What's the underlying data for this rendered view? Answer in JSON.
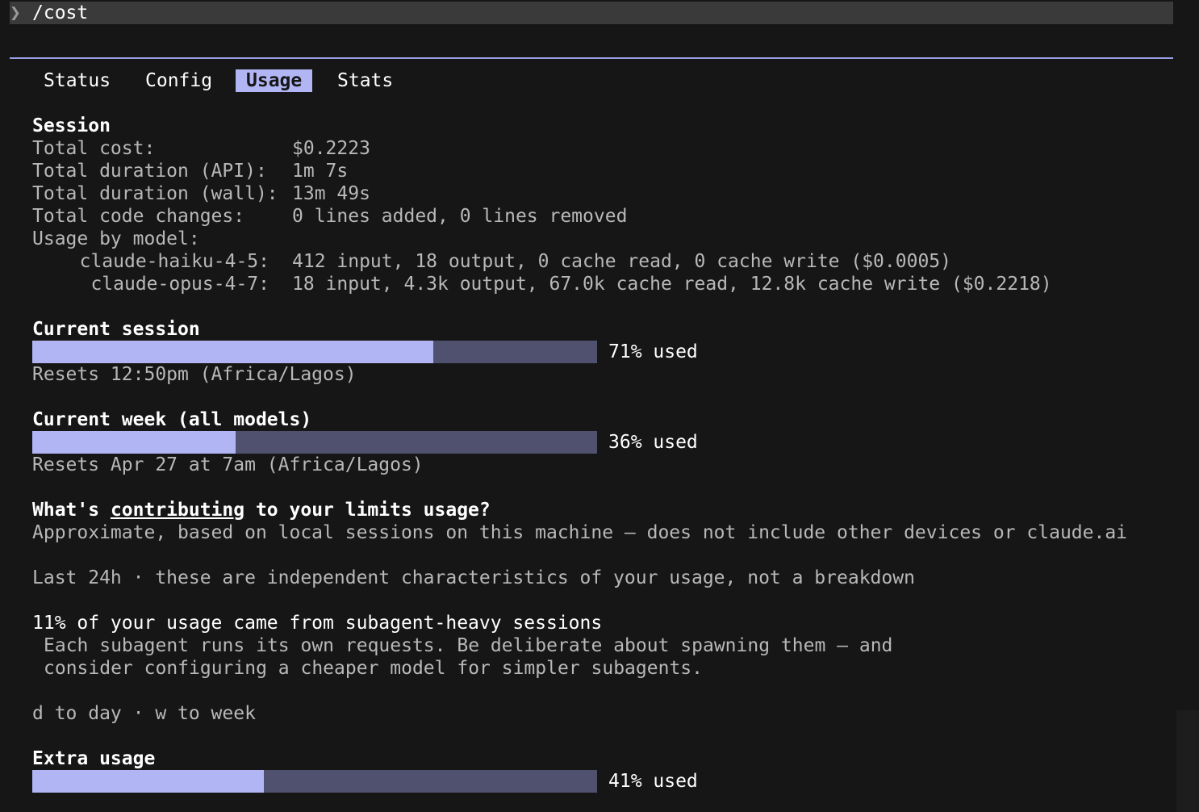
{
  "command": {
    "prompt_icon": "chevron-right-icon",
    "chevron": "❯",
    "text": "/cost"
  },
  "tabs": [
    {
      "label": "Status",
      "active": false
    },
    {
      "label": "Config",
      "active": false
    },
    {
      "label": "Usage",
      "active": true
    },
    {
      "label": "Stats",
      "active": false
    }
  ],
  "session": {
    "heading": "Session",
    "total_cost_label": "Total cost:",
    "total_cost_value": "$0.2223",
    "duration_api_label": "Total duration (API):",
    "duration_api_value": "1m 7s",
    "duration_wall_label": "Total duration (wall):",
    "duration_wall_value": "13m 49s",
    "code_changes_label": "Total code changes:",
    "code_changes_value": "0 lines added, 0 lines removed",
    "usage_by_model_label": "Usage by model:",
    "models": [
      {
        "name": "claude-haiku-4-5:",
        "usage": "412 input, 18 output, 0 cache read, 0 cache write ($0.0005)"
      },
      {
        "name": "claude-opus-4-7:",
        "usage": "18 input, 4.3k output, 67.0k cache read, 12.8k cache write ($0.2218)"
      }
    ]
  },
  "current_session": {
    "heading": "Current session",
    "percent_used": 71,
    "used_label": "71% used",
    "resets": "Resets 12:50pm (Africa/Lagos)"
  },
  "current_week": {
    "heading": "Current week (all models)",
    "percent_used": 36,
    "used_label": "36% used",
    "resets": "Resets Apr 27 at 7am (Africa/Lagos)"
  },
  "contributing": {
    "heading_pre": "What's ",
    "heading_link": "contributing",
    "heading_post": " to your limits usage?",
    "note": "Approximate, based on local sessions on this machine — does not include other devices or claude.ai",
    "period": "Last 24h · these are independent characteristics of your usage, not a breakdown",
    "insight_title": "11% of your usage came from subagent-heavy sessions",
    "insight_line1": "Each subagent runs its own requests. Be deliberate about spawning them — and",
    "insight_line2": "consider configuring a cheaper model for simpler subagents.",
    "keys_hint": "d to day · w to week"
  },
  "extra_usage": {
    "heading": "Extra usage",
    "percent_used": 41,
    "used_label": "41% used"
  },
  "colors": {
    "background": "#161616",
    "accent": "#b2b5f4",
    "bar_track": "#50516e",
    "divider": "#9c9fe6"
  }
}
